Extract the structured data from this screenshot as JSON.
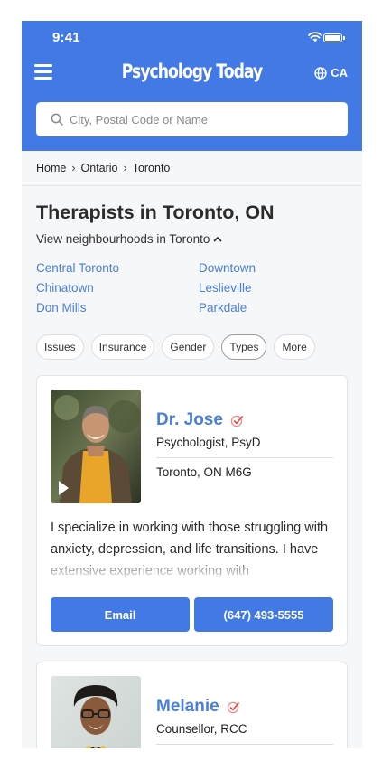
{
  "status_bar": {
    "time": "9:41"
  },
  "header": {
    "brand": "Psychology Today",
    "region_label": "CA",
    "menu_icon": "hamburger-menu-icon",
    "globe_icon": "globe-icon",
    "accent_color": "#4379e5"
  },
  "search": {
    "placeholder": "City, Postal Code or Name",
    "icon": "search-icon"
  },
  "breadcrumb": [
    "Home",
    "Ontario",
    "Toronto"
  ],
  "page": {
    "title": "Therapists in Toronto, ON",
    "neighbourhoods_toggle": "View neighbourhoods in Toronto"
  },
  "neighbourhoods": [
    "Central Toronto",
    "Downtown",
    "Chinatown",
    "Leslieville",
    "Don Mills",
    "Parkdale"
  ],
  "filters": [
    "Issues",
    "Insurance",
    "Gender",
    "Types",
    "More"
  ],
  "active_filter": "Types",
  "profiles": [
    {
      "name": "Dr. Jose",
      "credentials": "Psychologist, PsyD",
      "location": "Toronto, ON M6G",
      "bio": "I specialize in working with those struggling with anxiety, depression, and life transitions. I have extensive experience working with",
      "email_label": "Email",
      "phone_label": "(647) 493-5555",
      "has_video": true
    },
    {
      "name": "Melanie",
      "credentials": "Counsellor, RCC"
    }
  ],
  "verified_icon": "verified-check-icon"
}
